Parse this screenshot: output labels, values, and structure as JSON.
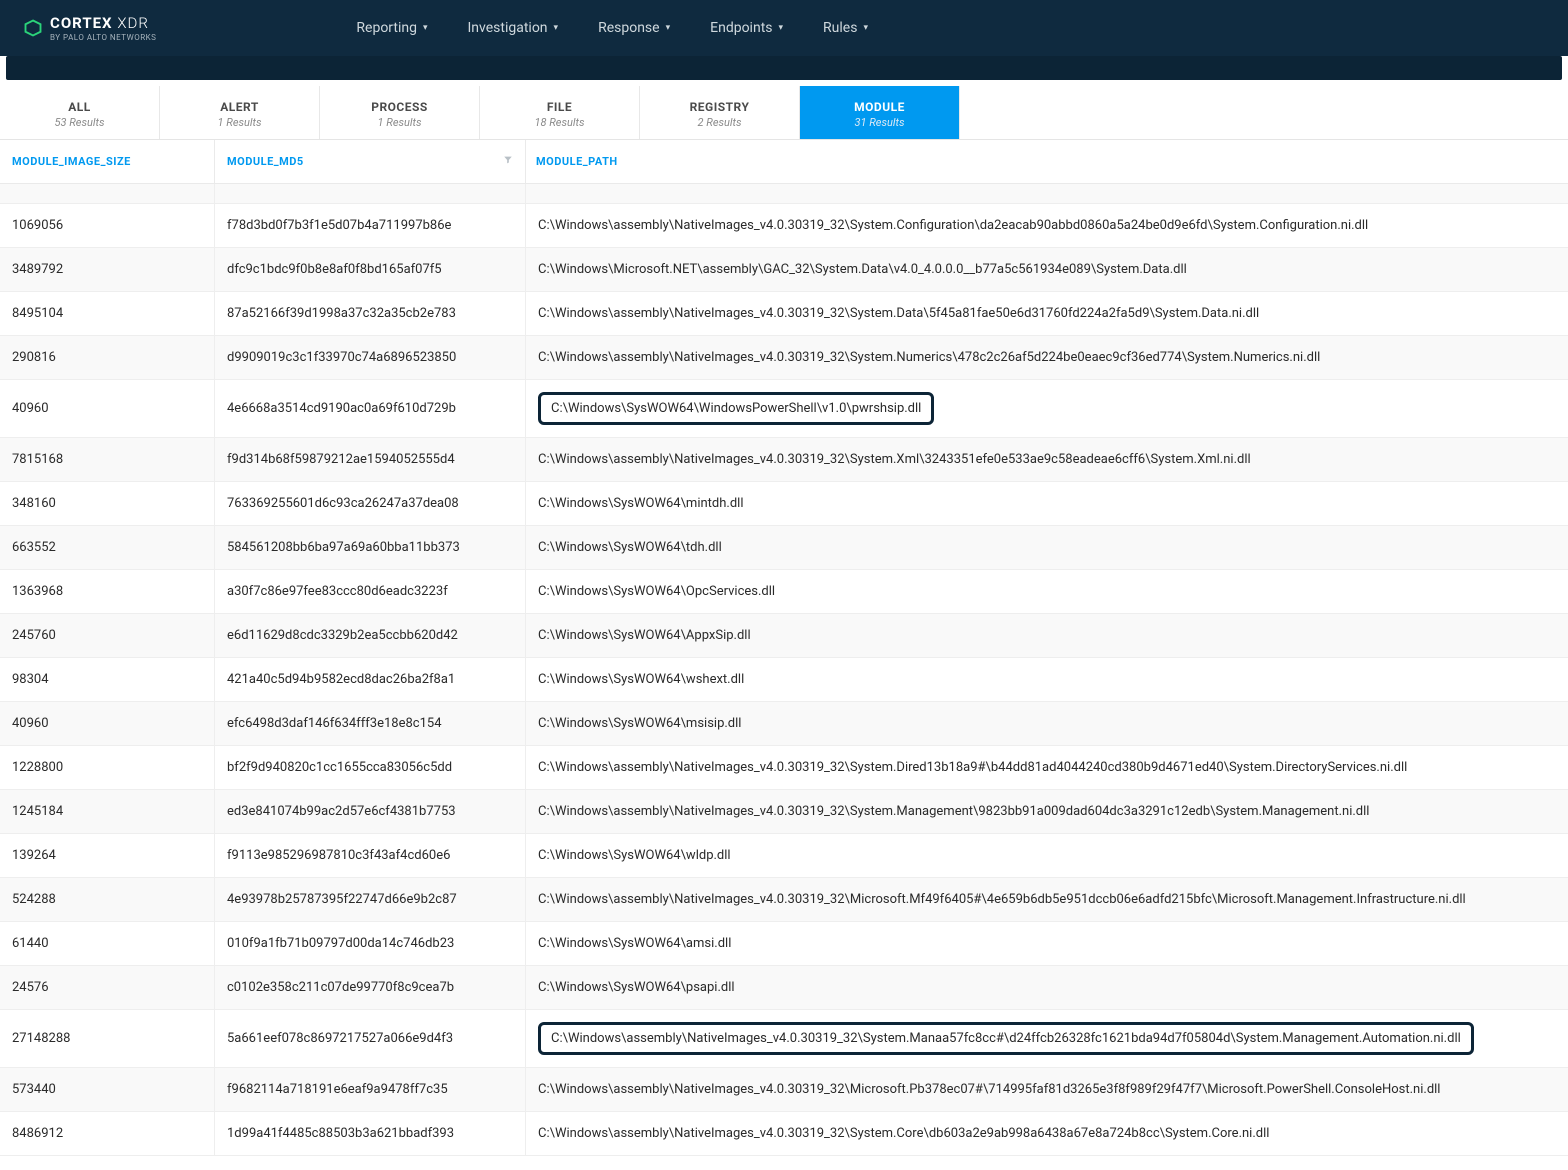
{
  "brand": {
    "name": "CORTEX",
    "suffix": "XDR",
    "tagline": "BY PALO ALTO NETWORKS"
  },
  "nav": [
    {
      "label": "Reporting"
    },
    {
      "label": "Investigation"
    },
    {
      "label": "Response"
    },
    {
      "label": "Endpoints"
    },
    {
      "label": "Rules"
    }
  ],
  "tabs": [
    {
      "label": "ALL",
      "sub": "53 Results",
      "active": false
    },
    {
      "label": "ALERT",
      "sub": "1 Results",
      "active": false
    },
    {
      "label": "PROCESS",
      "sub": "1 Results",
      "active": false
    },
    {
      "label": "FILE",
      "sub": "18 Results",
      "active": false
    },
    {
      "label": "REGISTRY",
      "sub": "2 Results",
      "active": false
    },
    {
      "label": "MODULE",
      "sub": "31 Results",
      "active": true
    }
  ],
  "columns": {
    "size": "MODULE_IMAGE_SIZE",
    "md5": "MODULE_MD5",
    "path": "MODULE_PATH"
  },
  "rows": [
    {
      "size": "1069056",
      "md5": "f78d3bd0f7b3f1e5d07b4a711997b86e",
      "path": "C:\\Windows\\assembly\\NativeImages_v4.0.30319_32\\System.Configuration\\da2eacab90abbd0860a5a24be0d9e6fd\\System.Configuration.ni.dll",
      "highlight": false
    },
    {
      "size": "3489792",
      "md5": "dfc9c1bdc9f0b8e8af0f8bd165af07f5",
      "path": "C:\\Windows\\Microsoft.NET\\assembly\\GAC_32\\System.Data\\v4.0_4.0.0.0__b77a5c561934e089\\System.Data.dll",
      "highlight": false
    },
    {
      "size": "8495104",
      "md5": "87a52166f39d1998a37c32a35cb2e783",
      "path": "C:\\Windows\\assembly\\NativeImages_v4.0.30319_32\\System.Data\\5f45a81fae50e6d31760fd224a2fa5d9\\System.Data.ni.dll",
      "highlight": false
    },
    {
      "size": "290816",
      "md5": "d9909019c3c1f33970c74a6896523850",
      "path": "C:\\Windows\\assembly\\NativeImages_v4.0.30319_32\\System.Numerics\\478c2c26af5d224be0eaec9cf36ed774\\System.Numerics.ni.dll",
      "highlight": false
    },
    {
      "size": "40960",
      "md5": "4e6668a3514cd9190ac0a69f610d729b",
      "path": "C:\\Windows\\SysWOW64\\WindowsPowerShell\\v1.0\\pwrshsip.dll",
      "highlight": true
    },
    {
      "size": "7815168",
      "md5": "f9d314b68f59879212ae1594052555d4",
      "path": "C:\\Windows\\assembly\\NativeImages_v4.0.30319_32\\System.Xml\\3243351efe0e533ae9c58eadeae6cff6\\System.Xml.ni.dll",
      "highlight": false
    },
    {
      "size": "348160",
      "md5": "763369255601d6c93ca26247a37dea08",
      "path": "C:\\Windows\\SysWOW64\\mintdh.dll",
      "highlight": false
    },
    {
      "size": "663552",
      "md5": "584561208bb6ba97a69a60bba11bb373",
      "path": "C:\\Windows\\SysWOW64\\tdh.dll",
      "highlight": false
    },
    {
      "size": "1363968",
      "md5": "a30f7c86e97fee83ccc80d6eadc3223f",
      "path": "C:\\Windows\\SysWOW64\\OpcServices.dll",
      "highlight": false
    },
    {
      "size": "245760",
      "md5": "e6d11629d8cdc3329b2ea5ccbb620d42",
      "path": "C:\\Windows\\SysWOW64\\AppxSip.dll",
      "highlight": false
    },
    {
      "size": "98304",
      "md5": "421a40c5d94b9582ecd8dac26ba2f8a1",
      "path": "C:\\Windows\\SysWOW64\\wshext.dll",
      "highlight": false
    },
    {
      "size": "40960",
      "md5": "efc6498d3daf146f634fff3e18e8c154",
      "path": "C:\\Windows\\SysWOW64\\msisip.dll",
      "highlight": false
    },
    {
      "size": "1228800",
      "md5": "bf2f9d940820c1cc1655cca83056c5dd",
      "path": "C:\\Windows\\assembly\\NativeImages_v4.0.30319_32\\System.Dired13b18a9#\\b44dd81ad4044240cd380b9d4671ed40\\System.DirectoryServices.ni.dll",
      "highlight": false
    },
    {
      "size": "1245184",
      "md5": "ed3e841074b99ac2d57e6cf4381b7753",
      "path": "C:\\Windows\\assembly\\NativeImages_v4.0.30319_32\\System.Management\\9823bb91a009dad604dc3a3291c12edb\\System.Management.ni.dll",
      "highlight": false
    },
    {
      "size": "139264",
      "md5": "f9113e985296987810c3f43af4cd60e6",
      "path": "C:\\Windows\\SysWOW64\\wldp.dll",
      "highlight": false
    },
    {
      "size": "524288",
      "md5": "4e93978b25787395f22747d66e9b2c87",
      "path": "C:\\Windows\\assembly\\NativeImages_v4.0.30319_32\\Microsoft.Mf49f6405#\\4e659b6db5e951dccb06e6adfd215bfc\\Microsoft.Management.Infrastructure.ni.dll",
      "highlight": false
    },
    {
      "size": "61440",
      "md5": "010f9a1fb71b09797d00da14c746db23",
      "path": "C:\\Windows\\SysWOW64\\amsi.dll",
      "highlight": false
    },
    {
      "size": "24576",
      "md5": "c0102e358c211c07de99770f8c9cea7b",
      "path": "C:\\Windows\\SysWOW64\\psapi.dll",
      "highlight": false
    },
    {
      "size": "27148288",
      "md5": "5a661eef078c8697217527a066e9d4f3",
      "path": "C:\\Windows\\assembly\\NativeImages_v4.0.30319_32\\System.Manaa57fc8cc#\\d24ffcb26328fc1621bda94d7f05804d\\System.Management.Automation.ni.dll",
      "highlight": true
    },
    {
      "size": "573440",
      "md5": "f9682114a718191e6eaf9a9478ff7c35",
      "path": "C:\\Windows\\assembly\\NativeImages_v4.0.30319_32\\Microsoft.Pb378ec07#\\714995faf81d3265e3f8f989f29f47f7\\Microsoft.PowerShell.ConsoleHost.ni.dll",
      "highlight": false
    },
    {
      "size": "8486912",
      "md5": "1d99a41f4485c88503b3a621bbadf393",
      "path": "C:\\Windows\\assembly\\NativeImages_v4.0.30319_32\\System.Core\\db603a2e9ab998a6438a67e8a724b8cc\\System.Core.ni.dll",
      "highlight": false
    }
  ]
}
